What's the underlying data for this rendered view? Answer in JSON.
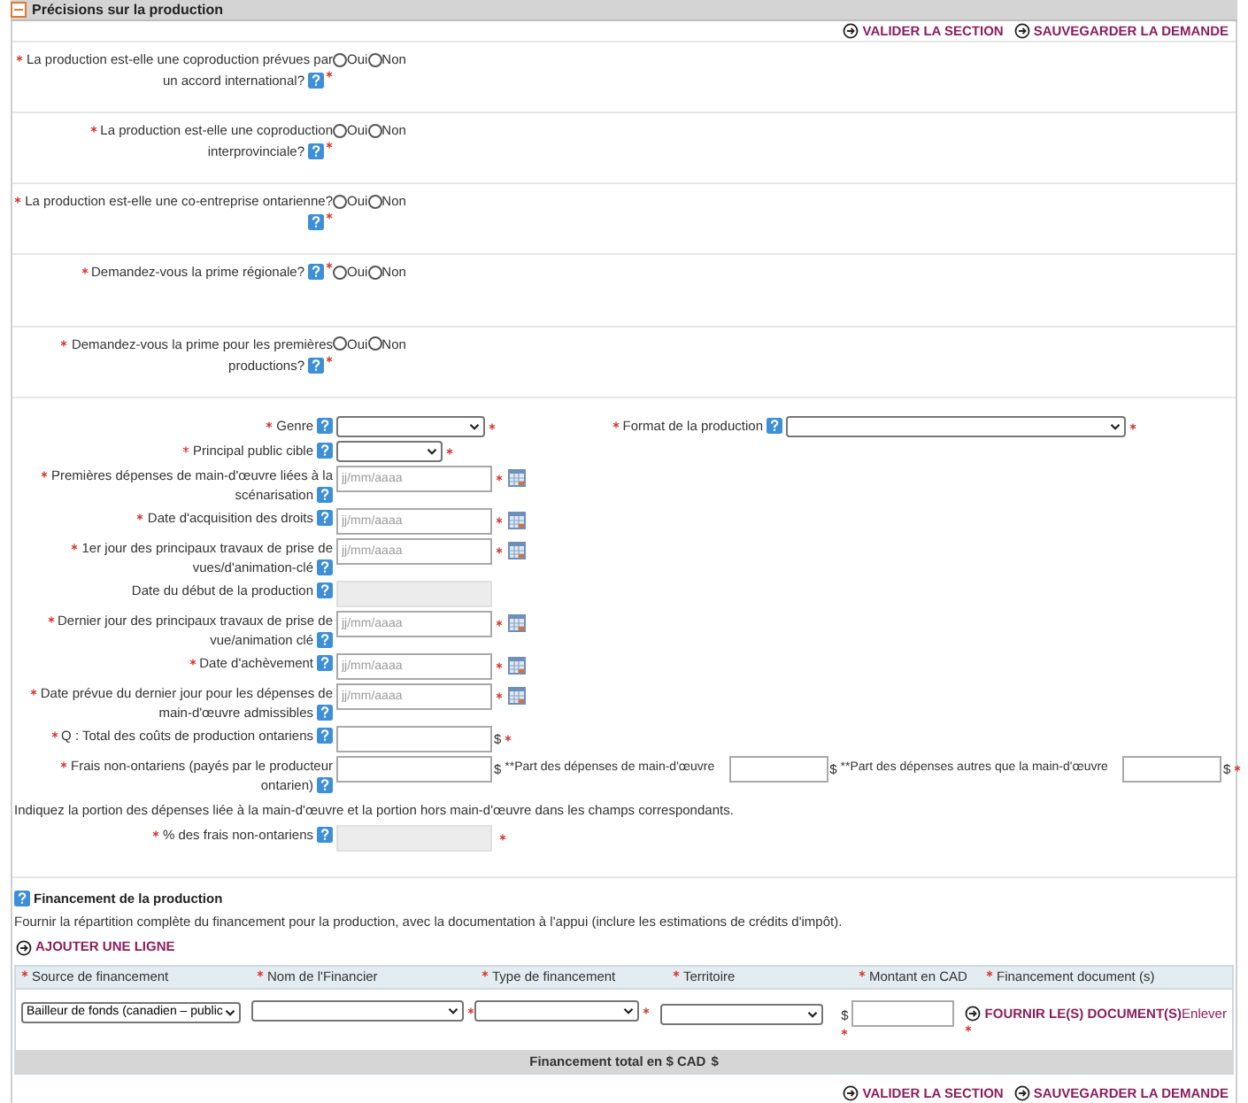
{
  "section": {
    "title": "Précisions sur la production",
    "expanded": true
  },
  "actions_top": [
    "VALIDER LA SECTION",
    "SAUVEGARDER LA DEMANDE"
  ],
  "questions": [
    {
      "label": "La production est-elle une coproduction prévues par un accord international?",
      "required": true,
      "options": [
        {
          "label": "Oui",
          "selected": false
        },
        {
          "label": "Non",
          "selected": false
        }
      ]
    },
    {
      "label": "La production est-elle une coproduction interprovinciale?",
      "required": true,
      "options": [
        {
          "label": "Oui",
          "selected": false
        },
        {
          "label": "Non",
          "selected": false
        }
      ]
    },
    {
      "label": "La production est-elle une co-entreprise ontarienne?",
      "required": true,
      "options": [
        {
          "label": "Oui",
          "selected": false
        },
        {
          "label": "Non",
          "selected": false
        }
      ]
    },
    {
      "label": "Demandez-vous la prime régionale?",
      "required": true,
      "options": [
        {
          "label": "Oui",
          "selected": false
        },
        {
          "label": "Non",
          "selected": false
        }
      ]
    },
    {
      "label": "Demandez-vous la prime pour les premières productions?",
      "required": true,
      "options": [
        {
          "label": "Oui",
          "selected": false
        },
        {
          "label": "Non",
          "selected": false
        }
      ]
    }
  ],
  "fields": [
    {
      "kind": "select",
      "label": "Genre",
      "required": true,
      "side_field": {
        "kind": "wide_select",
        "label": "Format de la production",
        "required": true
      }
    },
    {
      "kind": "short_select",
      "label": "Principal public cible",
      "required": true
    },
    {
      "kind": "date",
      "label": "Premières dépenses de main-d'œuvre liées à la scénarisation",
      "required": true,
      "placeholder": "jj/mm/aaaa"
    },
    {
      "kind": "date",
      "label": "Date d'acquisition des droits",
      "required": true,
      "placeholder": "jj/mm/aaaa"
    },
    {
      "kind": "date",
      "label": "1er jour des principaux travaux de prise de vues/d'animation-clé",
      "required": true,
      "placeholder": "jj/mm/aaaa"
    },
    {
      "kind": "readonly",
      "label": "Date du début de la production",
      "required": false
    },
    {
      "kind": "date",
      "label": "Dernier jour des principaux travaux de prise de vue/animation clé",
      "required": true,
      "placeholder": "jj/mm/aaaa"
    },
    {
      "kind": "date",
      "label": "Date d'achèvement",
      "required": true,
      "placeholder": "jj/mm/aaaa"
    },
    {
      "kind": "date",
      "label": "Date prévue du dernier jour pour les dépenses de main-d'œuvre admissibles",
      "required": true,
      "placeholder": "jj/mm/aaaa"
    },
    {
      "kind": "money",
      "label": "Q : Total des coûts de production ontariens",
      "required": true,
      "unit": "$"
    },
    {
      "kind": "money",
      "label": "Frais non-ontariens (payés par le producteur ontarien)",
      "required": true,
      "unit": "$",
      "extras": [
        {
          "label": "**Part des dépenses de main-d'œuvre",
          "unit": "$"
        },
        {
          "label": "**Part des dépenses autres que la main-d'œuvre",
          "unit": "$",
          "required": true
        }
      ]
    },
    {
      "kind": "note",
      "label": "Indiquez la portion des dépenses liée à la main-d'œuvre et la portion hors main-d'œuvre dans les champs correspondants."
    },
    {
      "kind": "readonly",
      "label": "% des frais non-ontariens",
      "required": true
    }
  ],
  "financing": {
    "title": "Financement de la production",
    "description": "Fournir la répartition complète du financement pour la production, avec la documentation à l'appui (inclure les estimations de crédits d'impôt).",
    "add_link": "AJOUTER UNE LIGNE",
    "columns": [
      {
        "label": "Source de financement",
        "required": true
      },
      {
        "label": "Nom de l'Financier",
        "required": true
      },
      {
        "label": "Type de financement",
        "required": true
      },
      {
        "label": "Territoire",
        "required": true
      },
      {
        "label": "Montant en CAD",
        "required": true
      },
      {
        "label": "Financement document (s)",
        "required": true
      }
    ],
    "row": {
      "source": "Bailleur de fonds (canadien – public",
      "currency": "$",
      "documents_link": "FOURNIR LE(S) DOCUMENT(S)",
      "remove_link": "Enlever"
    },
    "total_label": "Financement total en $ CAD",
    "total_value": "$"
  },
  "actions_bottom": [
    "VALIDER LA SECTION",
    "SAUVEGARDER LA DEMANDE"
  ]
}
